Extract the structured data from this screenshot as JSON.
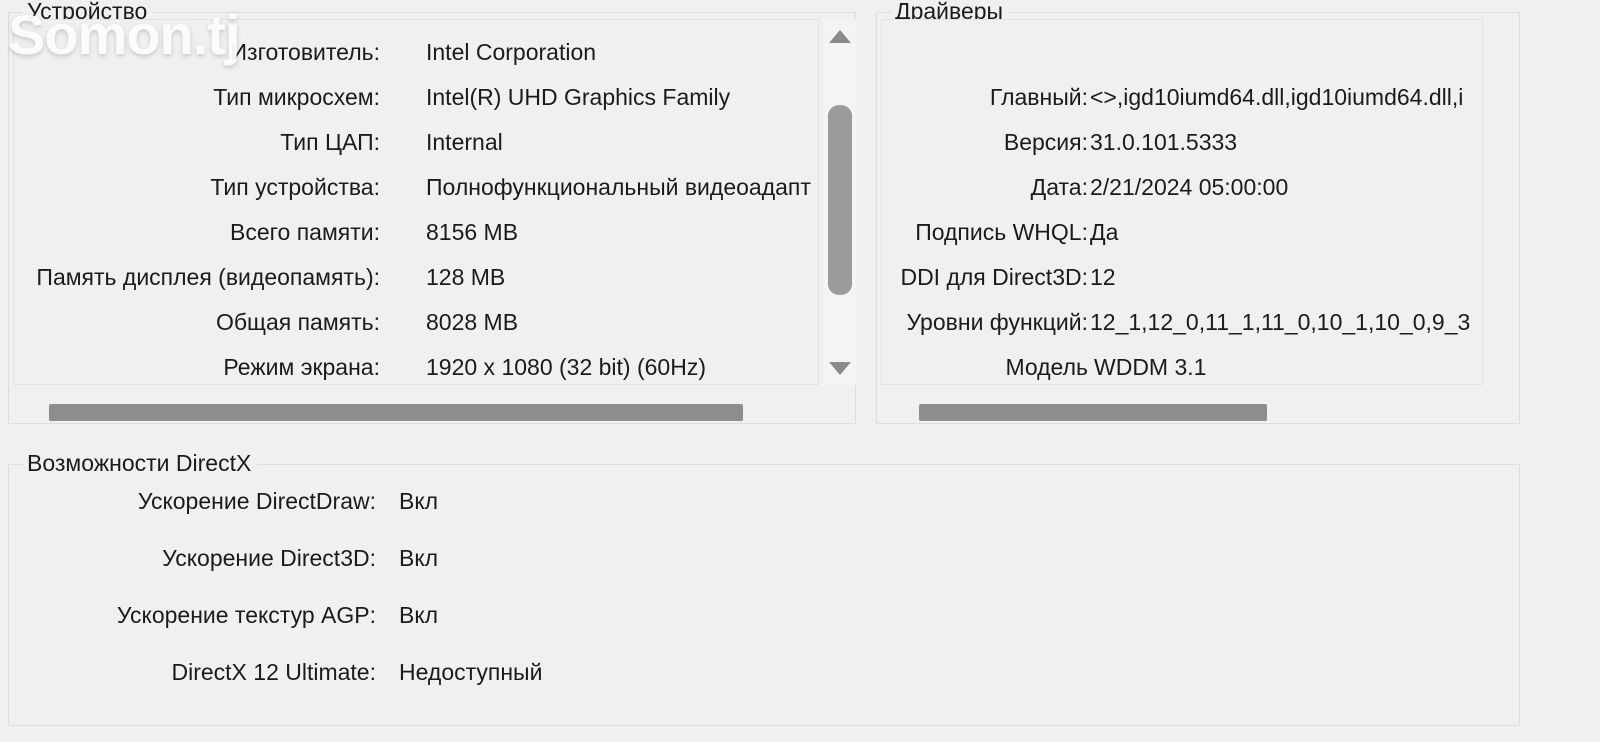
{
  "watermark": {
    "text": "Somon.tj"
  },
  "device_panel": {
    "title": "Устройство",
    "rows": [
      {
        "label": "Изготовитель:",
        "value": "Intel Corporation"
      },
      {
        "label": "Тип микросхем:",
        "value": "Intel(R) UHD Graphics Family"
      },
      {
        "label": "Тип ЦАП:",
        "value": "Internal"
      },
      {
        "label": "Тип устройства:",
        "value": "Полнофункциональный видеоадапт"
      },
      {
        "label": "Всего памяти:",
        "value": "8156 MB"
      },
      {
        "label": "Память дисплея (видеопамять):",
        "value": "128 MB"
      },
      {
        "label": "Общая память:",
        "value": "8028 MB"
      },
      {
        "label": "Режим экрана:",
        "value": "1920 x 1080 (32 bit) (60Hz)"
      }
    ],
    "scroll": {
      "vertical_up_icon": "scroll-up-arrow-icon",
      "vertical_down_icon": "scroll-down-arrow-icon",
      "horizontal_thumb": "horizontal-scroll-thumb"
    }
  },
  "drivers_panel": {
    "title": "Драйверы",
    "rows": [
      {
        "label": "Главный:",
        "value": "<>,igd10iumd64.dll,igd10iumd64.dll,i"
      },
      {
        "label": "Версия:",
        "value": "31.0.101.5333"
      },
      {
        "label": "Дата:",
        "value": "2/21/2024 05:00:00"
      },
      {
        "label": "Подпись WHQL:",
        "value": "Да"
      },
      {
        "label": "DDI для Direct3D:",
        "value": "12"
      },
      {
        "label": "Уровни функций:",
        "value": "12_1,12_0,11_1,11_0,10_1,10_0,9_3"
      },
      {
        "label": "Модель",
        "value": "WDDM 3.1"
      }
    ],
    "scroll": {
      "horizontal_thumb": "horizontal-scroll-thumb"
    }
  },
  "directx_features_panel": {
    "title": "Возможности DirectX",
    "rows": [
      {
        "label": "Ускорение DirectDraw:",
        "value": "Вкл"
      },
      {
        "label": "Ускорение Direct3D:",
        "value": "Вкл"
      },
      {
        "label": "Ускорение текстур AGP:",
        "value": "Вкл"
      },
      {
        "label": "DirectX 12 Ultimate:",
        "value": "Недоступный"
      }
    ]
  },
  "colors": {
    "background": "#f0f0f0",
    "text": "#1b1b1b",
    "border": "#dcdcdc",
    "scroll_thumb": "#9b9b9b",
    "scroll_arrow": "#8a8a8a"
  }
}
